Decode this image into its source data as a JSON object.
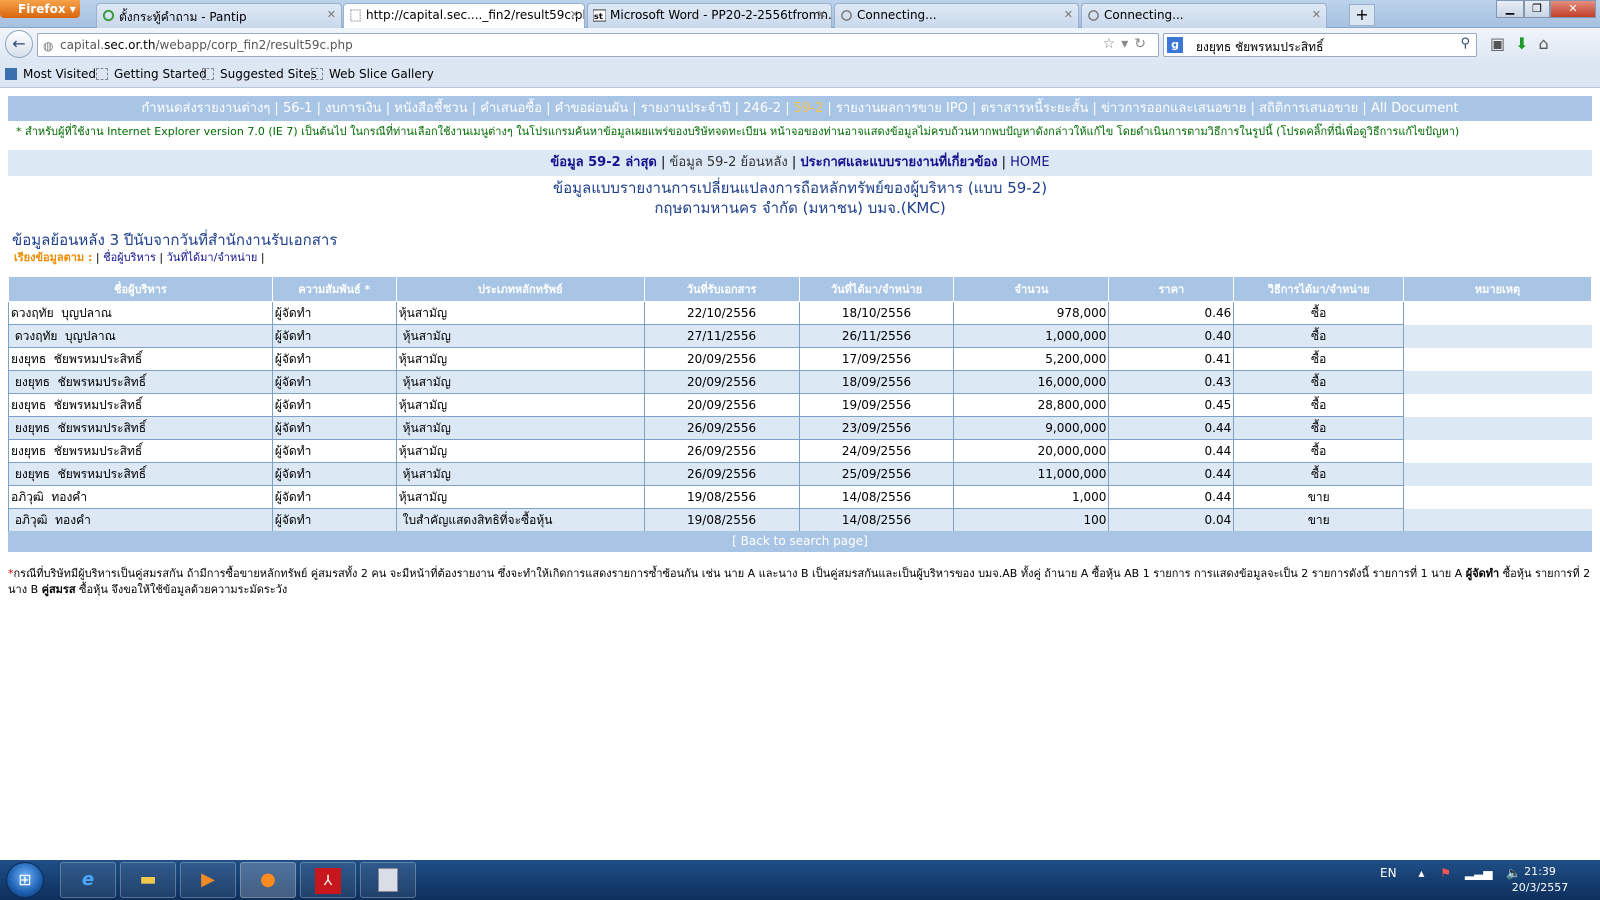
{
  "browser": {
    "menu_label": "Firefox",
    "tabs": [
      {
        "title": "ตั้งกระทู้คำถาม - Pantip"
      },
      {
        "title": "http://capital.sec...._fin2/result59c.php"
      },
      {
        "title": "Microsoft Word - PP20-2-2556tfromn..."
      },
      {
        "title": "Connecting..."
      },
      {
        "title": "Connecting..."
      }
    ],
    "new_tab": "+",
    "url": {
      "scheme_host": "capital.",
      "domain": "sec.or.th",
      "path": "/webapp/corp_fin2/result59c.php"
    },
    "search": {
      "engine": "g",
      "value": "ยงยุทธ  ชัยพรหมประสิทธิ์"
    },
    "bookmarks": [
      "Most Visited",
      "Getting Started",
      "Suggested Sites",
      "Web Slice Gallery"
    ]
  },
  "page": {
    "top_menu": [
      "กำหนดส่งรายงานต่างๆ",
      "56-1",
      "งบการเงิน",
      "หนังสือชี้ชวน",
      "คำเสนอซื้อ",
      "คำขอผ่อนผัน",
      "รายงานประจำปี",
      "246-2",
      "59-2",
      "รายงานผลการขาย IPO",
      "ตราสารหนี้ระยะสั้น",
      "ข่าวการออกและเสนอขาย",
      "สถิติการเสนอขาย",
      "All Document"
    ],
    "ie_note": "* สำหรับผู้ที่ใช้งาน Internet Explorer version 7.0 (IE 7) เป็นต้นไป ในกรณีที่ท่านเลือกใช้งานเมนูต่างๆ ในโปรแกรมค้นหาข้อมูลเผยแพร่ของบริษัทจดทะเบียน หน้าจอของท่านอาจแสดงข้อมูลไม่ครบถ้วนหากพบปัญหาดังกล่าวให้แก้ไข โดยดำเนินการตามวิธีการในรูปนี้ (โปรดคลิ๊กที่นี่เพื่อดูวิธีการแก้ไขปัญหา)",
    "sub_menu": {
      "latest": "ข้อมูล 59-2 ล่าสุด",
      "history": "ข้อมูล 59-2 ย้อนหลัง",
      "notices": "ประกาศและแบบรายงานที่เกี่ยวข้อง",
      "home": "HOME"
    },
    "title_line1": "ข้อมูลแบบรายงานการเปลี่ยนแปลงการถือหลักทรัพย์ของผู้บริหาร (แบบ 59-2)",
    "title_line2": "กฤษดามหานคร จำกัด (มหาชน) บมจ.(KMC)",
    "history_note": "ข้อมูลย้อนหลัง 3 ปีนับจากวันที่สำนักงานรับเอกสาร",
    "sort_label": "เรียงข้อมูลตาม :",
    "sort_by_name": "ชื่อผู้บริหาร",
    "sort_by_date": "วันที่ได้มา/จำหน่าย",
    "table": {
      "headers": [
        "ชื่อผู้บริหาร",
        "ความสัมพันธ์ *",
        "ประเภทหลักทรัพย์",
        "วันที่รับเอกสาร",
        "วันที่ได้มา/จำหน่าย",
        "จำนวน",
        "ราคา",
        "วิธีการได้มา/จำหน่าย",
        "หมายเหตุ"
      ],
      "rows": [
        {
          "name": "ดวงฤทัย  บุญปลาณ",
          "relation": "ผู้จัดทำ",
          "type": "หุ้นสามัญ",
          "received": "22/10/2556",
          "traded": "18/10/2556",
          "amount": "978,000",
          "price": "0.46",
          "method": "ซื้อ",
          "remark": ""
        },
        {
          "name": " ดวงฤทัย  บุญปลาณ",
          "relation": "ผู้จัดทำ",
          "type": " หุ้นสามัญ",
          "received": "27/11/2556",
          "traded": "26/11/2556",
          "amount": "1,000,000",
          "price": "0.40",
          "method": "ซื้อ",
          "remark": ""
        },
        {
          "name": "ยงยุทธ  ชัยพรหมประสิทธิ์",
          "relation": "ผู้จัดทำ",
          "type": "หุ้นสามัญ",
          "received": "20/09/2556",
          "traded": "17/09/2556",
          "amount": "5,200,000",
          "price": "0.41",
          "method": "ซื้อ",
          "remark": ""
        },
        {
          "name": " ยงยุทธ  ชัยพรหมประสิทธิ์",
          "relation": "ผู้จัดทำ",
          "type": " หุ้นสามัญ",
          "received": "20/09/2556",
          "traded": "18/09/2556",
          "amount": "16,000,000",
          "price": "0.43",
          "method": "ซื้อ",
          "remark": ""
        },
        {
          "name": "ยงยุทธ  ชัยพรหมประสิทธิ์",
          "relation": "ผู้จัดทำ",
          "type": "หุ้นสามัญ",
          "received": "20/09/2556",
          "traded": "19/09/2556",
          "amount": "28,800,000",
          "price": "0.45",
          "method": "ซื้อ",
          "remark": ""
        },
        {
          "name": " ยงยุทธ  ชัยพรหมประสิทธิ์",
          "relation": "ผู้จัดทำ",
          "type": " หุ้นสามัญ",
          "received": "26/09/2556",
          "traded": "23/09/2556",
          "amount": "9,000,000",
          "price": "0.44",
          "method": "ซื้อ",
          "remark": ""
        },
        {
          "name": "ยงยุทธ  ชัยพรหมประสิทธิ์",
          "relation": "ผู้จัดทำ",
          "type": "หุ้นสามัญ",
          "received": "26/09/2556",
          "traded": "24/09/2556",
          "amount": "20,000,000",
          "price": "0.44",
          "method": "ซื้อ",
          "remark": ""
        },
        {
          "name": " ยงยุทธ  ชัยพรหมประสิทธิ์",
          "relation": "ผู้จัดทำ",
          "type": " หุ้นสามัญ",
          "received": "26/09/2556",
          "traded": "25/09/2556",
          "amount": "11,000,000",
          "price": "0.44",
          "method": "ซื้อ",
          "remark": ""
        },
        {
          "name": "อภิวุฒิ  ทองคำ",
          "relation": "ผู้จัดทำ",
          "type": "หุ้นสามัญ",
          "received": "19/08/2556",
          "traded": "14/08/2556",
          "amount": "1,000",
          "price": "0.44",
          "method": "ขาย",
          "remark": ""
        },
        {
          "name": " อภิวุฒิ  ทองคำ",
          "relation": "ผู้จัดทำ",
          "type": " ใบสำคัญแสดงสิทธิที่จะซื้อหุ้น",
          "received": "19/08/2556",
          "traded": "14/08/2556",
          "amount": "100",
          "price": "0.04",
          "method": "ขาย",
          "remark": ""
        }
      ]
    },
    "back_link": "[ Back to search page]",
    "footnote_star": "*",
    "footnote_a": "กรณีที่บริษัทมีผู้บริหารเป็นคู่สมรสกัน ถ้ามีการซื้อขายหลักทรัพย์ คู่สมรสทั้ง 2 คน จะมีหน้าที่ต้องรายงาน ซึ่งจะทำให้เกิดการแสดงรายการซ้ำซ้อนกัน เช่น นาย A และนาง B เป็นคู่สมรสกันและเป็นผู้บริหารของ บมจ.AB ทั้งคู่ ถ้านาย A ซื้อหุ้น AB 1 รายการ การแสดงข้อมูลจะเป็น 2 รายการดังนี้ รายการที่ 1 นาย A ",
    "footnote_b1": "ผู้จัดทำ",
    "footnote_c": " ซื้อหุ้น รายการที่ 2 นาง B ",
    "footnote_b2": "คู่สมรส",
    "footnote_d": " ซื้อหุ้น จึงขอให้ใช้ข้อมูลด้วยความระมัดระวัง"
  },
  "taskbar": {
    "lang": "EN",
    "time": "21:39",
    "date": "20/3/2557"
  },
  "colors": {
    "header_blue": "#a9c5e6",
    "row_alt": "#dde8f5",
    "link_navy": "#14148f",
    "note_green": "#006b00",
    "highlight_orange": "#f6c44c"
  }
}
